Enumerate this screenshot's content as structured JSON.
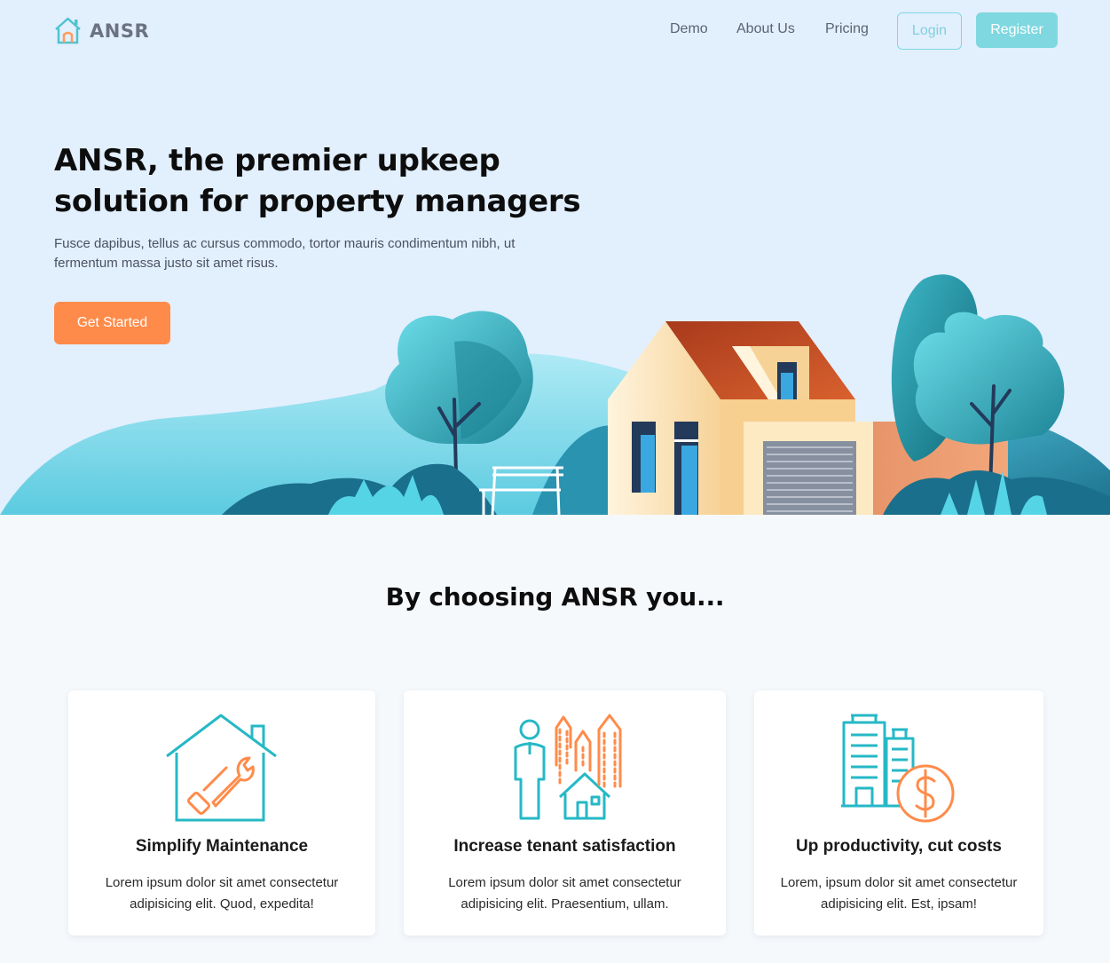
{
  "header": {
    "brand": "ANSR",
    "nav": [
      "Demo",
      "About Us",
      "Pricing"
    ],
    "login_label": "Login",
    "register_label": "Register"
  },
  "hero": {
    "title": "ANSR, the premier upkeep solution for property managers",
    "subtitle": "Fusce dapibus, tellus ac cursus commodo, tortor mauris condimentum nibh, ut fermentum massa justo sit amet risus.",
    "cta_label": "Get Started"
  },
  "features": {
    "heading": "By choosing ANSR you...",
    "cards": [
      {
        "icon": "house-wrench-icon",
        "title": "Simplify Maintenance",
        "text": "Lorem ipsum dolor sit amet consectetur adipisicing elit. Quod, expedita!"
      },
      {
        "icon": "person-house-growth-icon",
        "title": "Increase tenant satisfaction",
        "text": "Lorem ipsum dolor sit amet consectetur adipisicing elit. Praesentium, ullam."
      },
      {
        "icon": "buildings-dollar-icon",
        "title": "Up productivity, cut costs",
        "text": "Lorem, ipsum dolor sit amet consectetur adipisicing elit. Est, ipsam!"
      }
    ]
  },
  "colors": {
    "accent_teal": "#7fd8e0",
    "accent_orange": "#ff8b4a",
    "hero_bg": "#e2effd",
    "page_bg": "#f6f9fc"
  }
}
